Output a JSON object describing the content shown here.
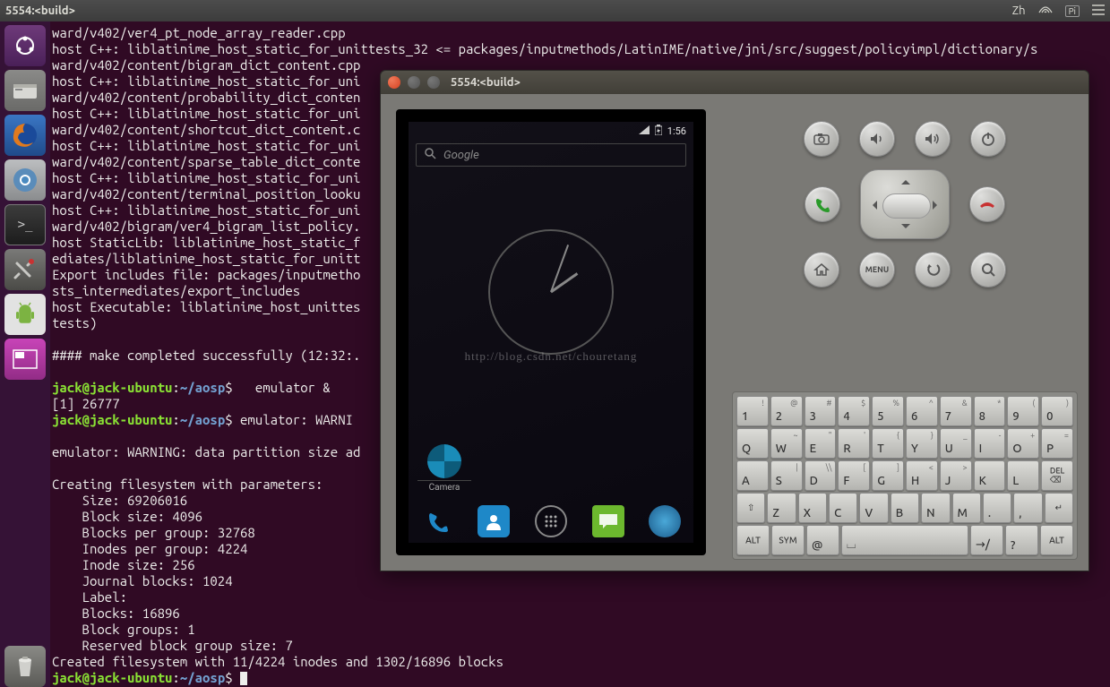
{
  "topbar": {
    "title": "5554:<build>",
    "indicators": [
      "Zh"
    ]
  },
  "terminal": {
    "lines": [
      "ward/v402/ver4_pt_node_array_reader.cpp",
      "host C++: liblatinime_host_static_for_unittests_32 <= packages/inputmethods/LatinIME/native/jni/src/suggest/policyimpl/dictionary/s",
      "ward/v402/content/bigram_dict_content.cpp",
      "host C++: liblatinime_host_static_for_uni                                                                                          y/s",
      "ward/v402/content/probability_dict_conten",
      "host C++: liblatinime_host_static_for_uni                                                                                          y/s",
      "ward/v402/content/shortcut_dict_content.c",
      "host C++: liblatinime_host_static_for_uni                                                                                          y/s",
      "ward/v402/content/sparse_table_dict_conte",
      "host C++: liblatinime_host_static_for_uni                                                                                          y/s",
      "ward/v402/content/terminal_position_looku",
      "host C++: liblatinime_host_static_for_uni                                                                                          y/s",
      "ward/v402/bigram/ver4_bigram_list_policy.",
      "host StaticLib: liblatinime_host_static_f                                                                                          uni",
      "ediates/liblatinime_host_static_for_unitt",
      "Export includes file: packages/inputmetho                                                                                          nim",
      "sts_intermediates/export_includes",
      "host Executable: liblatinime_host_unittes                                                                                          tim",
      "tests)",
      "",
      "#### make completed successfully (12:32:.",
      ""
    ],
    "prompt_user": "jack@jack-ubuntu",
    "prompt_path": "~/aosp",
    "cmd1": "  emulator &",
    "jobline": "[1] 26777",
    "cmd2": "emulator: WARNI",
    "warn": "emulator: WARNING: data partition size ad",
    "fs_header": "Creating filesystem with parameters:",
    "fs_lines": [
      "    Size: 69206016",
      "    Block size: 4096",
      "    Blocks per group: 32768",
      "    Inodes per group: 4224",
      "    Inode size: 256",
      "    Journal blocks: 1024",
      "    Label:",
      "    Blocks: 16896",
      "    Block groups: 1",
      "    Reserved block group size: 7"
    ],
    "created": "Created filesystem with 11/4224 inodes and 1302/16896 blocks"
  },
  "emulator": {
    "title": "5554:<build>",
    "phone": {
      "time": "1:56",
      "search_placeholder": "Google",
      "watermark": "http://blog.csdn.net/chouretang",
      "camera_label": "Camera"
    },
    "hw_buttons": {
      "menu_label": "MENU"
    },
    "keyboard": {
      "row1": [
        {
          "m": "1",
          "s": "!"
        },
        {
          "m": "2",
          "s": "@"
        },
        {
          "m": "3",
          "s": "#"
        },
        {
          "m": "4",
          "s": "$"
        },
        {
          "m": "5",
          "s": "%"
        },
        {
          "m": "6",
          "s": "^"
        },
        {
          "m": "7",
          "s": "&"
        },
        {
          "m": "8",
          "s": "*"
        },
        {
          "m": "9",
          "s": "("
        },
        {
          "m": "0",
          "s": ")"
        }
      ],
      "row2": [
        {
          "m": "Q"
        },
        {
          "m": "W",
          "s": "~"
        },
        {
          "m": "E",
          "s": "\""
        },
        {
          "m": "R",
          "s": "'"
        },
        {
          "m": "T",
          "s": "{"
        },
        {
          "m": "Y",
          "s": "}"
        },
        {
          "m": "U",
          "s": "_"
        },
        {
          "m": "I",
          "s": "-"
        },
        {
          "m": "O",
          "s": "+"
        },
        {
          "m": "P",
          "s": "="
        }
      ],
      "row3": [
        {
          "m": "A"
        },
        {
          "m": "S",
          "s": "|"
        },
        {
          "m": "D",
          "s": "\\\\"
        },
        {
          "m": "F",
          "s": "["
        },
        {
          "m": "G",
          "s": "]"
        },
        {
          "m": "H",
          "s": "<"
        },
        {
          "m": "J",
          "s": ">"
        },
        {
          "m": "K",
          ";": ";"
        },
        {
          "m": "L",
          ";": ":"
        },
        {
          "m": "DEL",
          "del": true
        }
      ],
      "row4": [
        {
          "m": "⇧",
          "shift": true
        },
        {
          "m": "Z"
        },
        {
          "m": "X"
        },
        {
          "m": "C"
        },
        {
          "m": "V"
        },
        {
          "m": "B"
        },
        {
          "m": "N"
        },
        {
          "m": "M"
        },
        {
          "m": "."
        },
        {
          "m": ",",
          "s": ""
        }
      ],
      "row5": [
        {
          "m": "ALT",
          "mod": true
        },
        {
          "m": "SYM",
          "mod": true
        },
        {
          "m": "@"
        },
        {
          "m": "",
          "space": true
        },
        {
          "m": "→/"
        },
        {
          "m": "?",
          "s": ""
        },
        {
          "m": "ALT",
          "mod": true
        }
      ],
      "enter_label": "↵"
    }
  }
}
